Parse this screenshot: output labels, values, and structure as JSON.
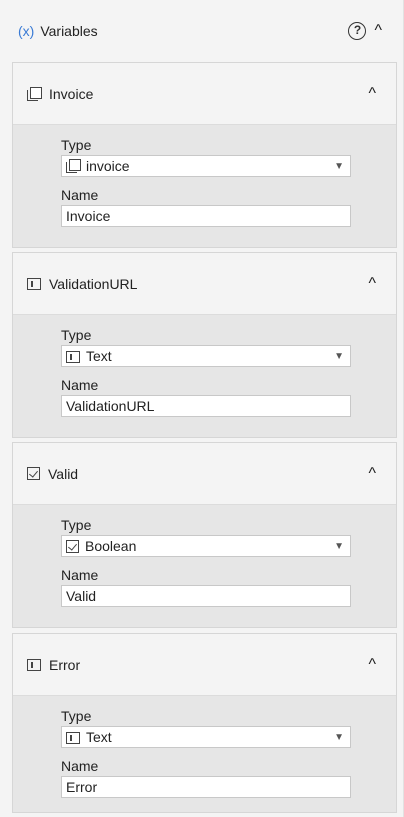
{
  "header": {
    "icon_text": "(x)",
    "title": "Variables",
    "help_glyph": "?",
    "collapse_glyph": "^"
  },
  "variables": [
    {
      "title": "Invoice",
      "icon": "object-icon",
      "type_label": "Type",
      "type_value": "invoice",
      "name_label": "Name",
      "name_value": "Invoice",
      "collapse_glyph": "^"
    },
    {
      "title": "ValidationURL",
      "icon": "text-icon",
      "type_label": "Type",
      "type_value": "Text",
      "name_label": "Name",
      "name_value": "ValidationURL",
      "collapse_glyph": "^"
    },
    {
      "title": "Valid",
      "icon": "checkbox-icon",
      "type_label": "Type",
      "type_value": "Boolean",
      "name_label": "Name",
      "name_value": "Valid",
      "collapse_glyph": "^"
    },
    {
      "title": "Error",
      "icon": "text-icon",
      "type_label": "Type",
      "type_value": "Text",
      "name_label": "Name",
      "name_value": "Error",
      "collapse_glyph": "^"
    }
  ],
  "select_arrow_glyph": "▼"
}
